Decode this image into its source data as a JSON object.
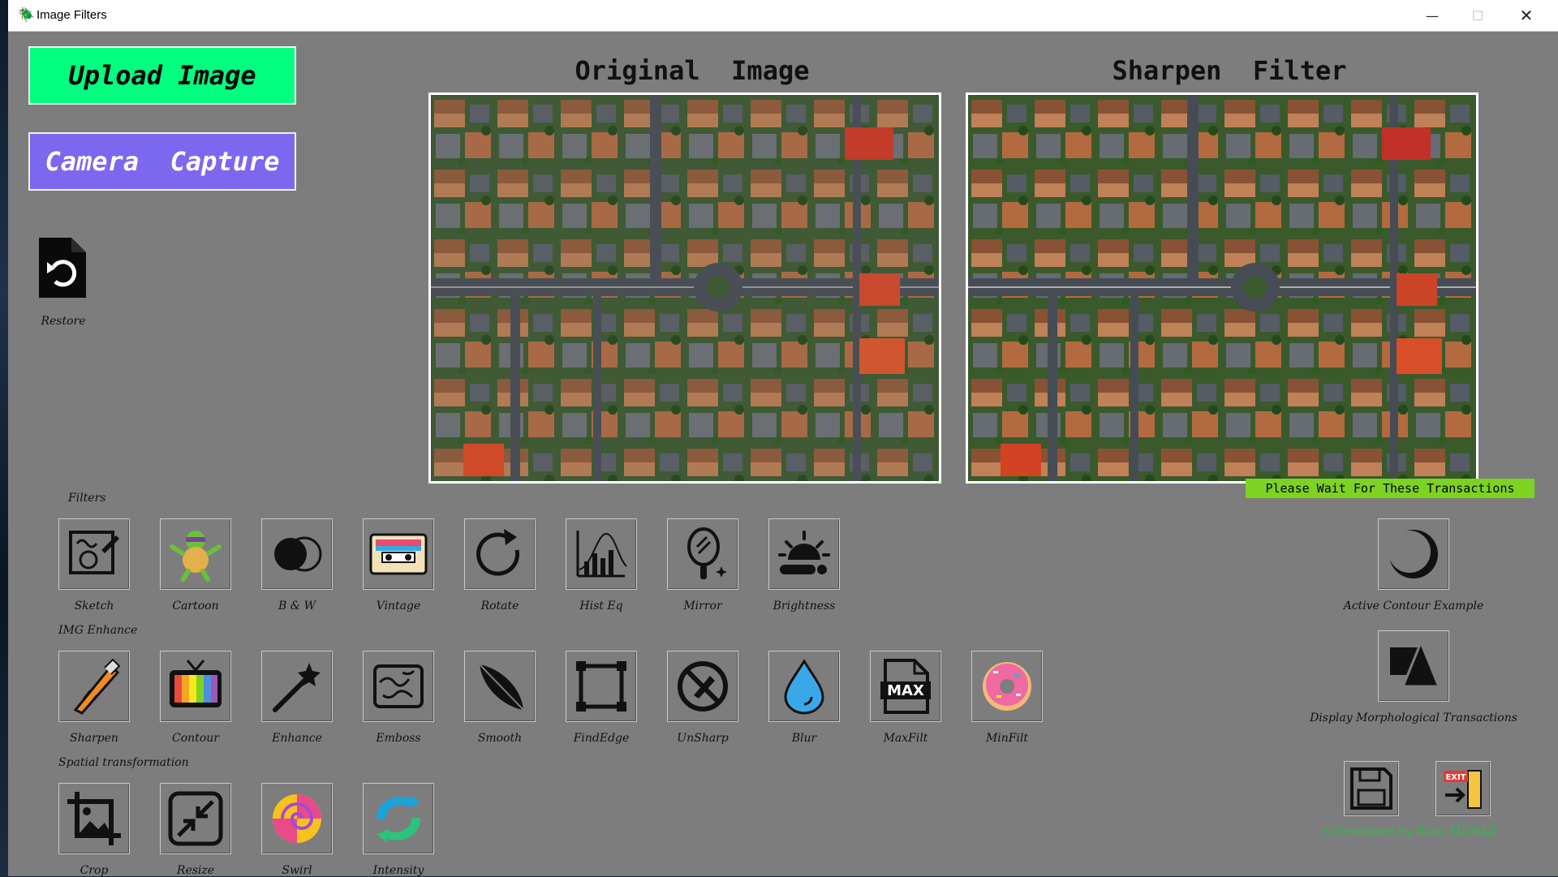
{
  "window": {
    "title": "Image Filters",
    "min_glyph": "—",
    "max_glyph": "☐",
    "close_glyph": "✕"
  },
  "buttons": {
    "upload": "Upload Image",
    "camera": "Camera  Capture",
    "restore": "Restore"
  },
  "panels": {
    "original_title": "Original  Image",
    "filtered_title": "Sharpen  Filter"
  },
  "status": "Please Wait For These Transactions",
  "sections": {
    "filters": "Filters",
    "enhance": "IMG Enhance",
    "spatial": "Spatial transformation"
  },
  "filters": [
    "Sketch",
    "Cartoon",
    "B & W",
    "Vintage",
    "Rotate",
    "Hist Eq",
    "Mirror",
    "Brightness"
  ],
  "enhance": [
    "Sharpen",
    "Contour",
    "Enhance",
    "Emboss",
    "Smooth",
    "FindEdge",
    "UnSharp",
    "Blur",
    "MaxFilt",
    "MinFilt"
  ],
  "spatial": [
    "Crop",
    "Resize",
    "Swirl",
    "Intensity"
  ],
  "right_tools": {
    "active_contour": "Active Contour Example",
    "morph": "Display Morphological Transactions"
  },
  "credits": "©Developed by Rana YILMAZ",
  "colors": {
    "upload_bg": "#00ff7f",
    "camera_bg": "#7b68ee",
    "status_bg": "#7cd321",
    "window_bg": "#7d7d7d",
    "credits": "#2fb84a"
  }
}
